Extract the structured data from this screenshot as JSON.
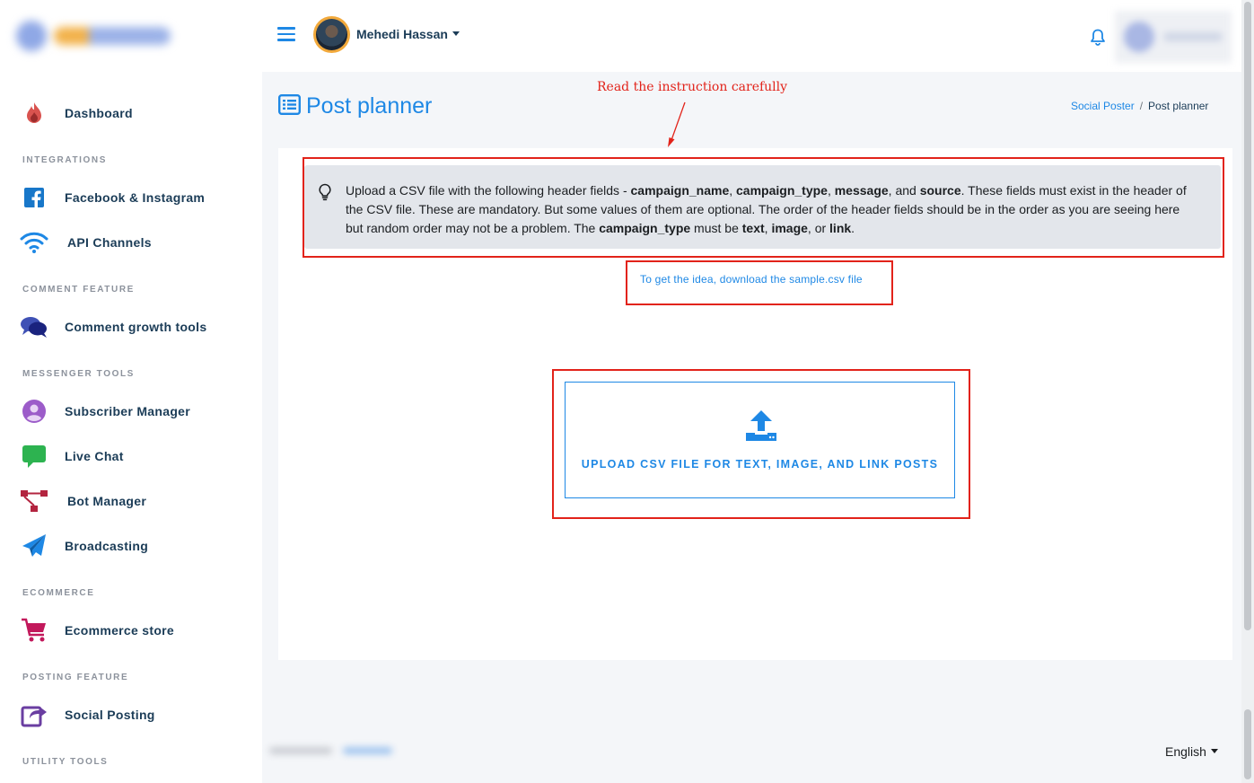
{
  "sidebar": {
    "sections": {
      "integrations": "INTEGRATIONS",
      "comment": "COMMENT FEATURE",
      "messenger": "MESSENGER TOOLS",
      "ecommerce": "ECOMMERCE",
      "posting": "POSTING FEATURE",
      "utility": "UTILITY TOOLS"
    },
    "items": [
      {
        "label": "Dashboard",
        "icon": "fire-icon"
      },
      {
        "label": "Facebook & Instagram",
        "icon": "facebook-icon"
      },
      {
        "label": "API Channels",
        "icon": "wifi-icon"
      },
      {
        "label": "Comment growth tools",
        "icon": "comments-icon"
      },
      {
        "label": "Subscriber Manager",
        "icon": "user-circle-icon"
      },
      {
        "label": "Live Chat",
        "icon": "chat-icon"
      },
      {
        "label": "Bot Manager",
        "icon": "sitemap-icon"
      },
      {
        "label": "Broadcasting",
        "icon": "paper-plane-icon"
      },
      {
        "label": "Ecommerce store",
        "icon": "cart-icon"
      },
      {
        "label": "Social Posting",
        "icon": "share-icon"
      }
    ]
  },
  "topbar": {
    "user_name": "Mehedi Hassan"
  },
  "page": {
    "title": "Post planner",
    "breadcrumb": {
      "parent": "Social Poster",
      "separator": "/",
      "current": "Post planner"
    }
  },
  "annotation": {
    "text": "Read the instruction carefully"
  },
  "instruction": {
    "p1": "Upload a CSV file with the following header fields - ",
    "f1": "campaign_name",
    "c1": ", ",
    "f2": "campaign_type",
    "c2": ", ",
    "f3": "message",
    "c3": ", and ",
    "f4": "source",
    "p2": ". These fields must exist in the header of the CSV file. These are mandatory. But some values of them are optional. The order of the header fields should be in the order as you are seeing here but random order may not be a problem. The ",
    "f5": "campaign_type",
    "p3": " must be ",
    "t1": "text",
    "c4": ", ",
    "t2": "image",
    "c5": ", or ",
    "t3": "link",
    "p4": "."
  },
  "download_link": "To get the idea, download the sample.csv file",
  "upload": {
    "label": "UPLOAD CSV FILE FOR TEXT, IMAGE, AND LINK POSTS"
  },
  "footer": {
    "language": "English"
  },
  "colors": {
    "accent": "#1e88e5",
    "annotation_red": "#e2231a",
    "alert_bg": "#e3e6eb"
  }
}
